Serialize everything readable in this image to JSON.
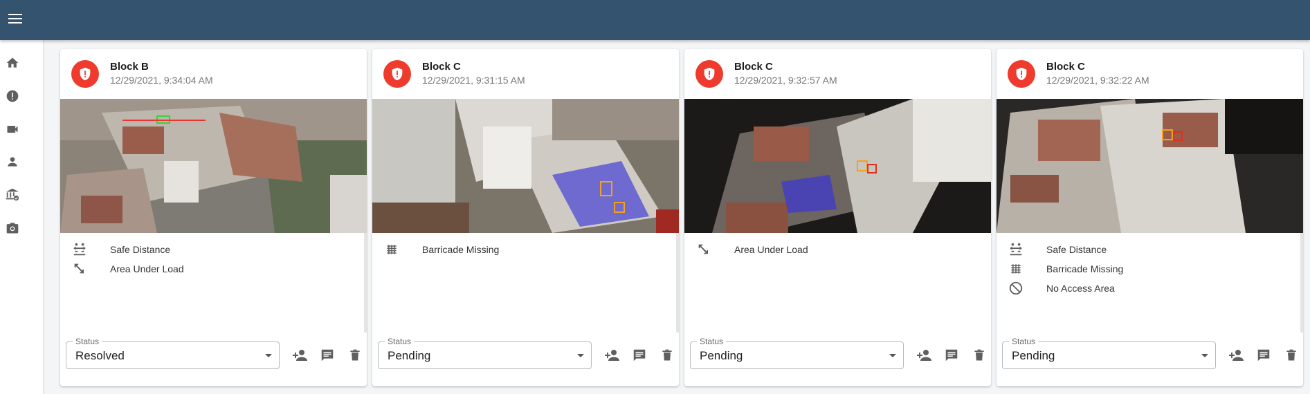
{
  "status_field_label": "Status",
  "colors": {
    "appbar": "#34536f",
    "alert": "#ef3b2d",
    "icon": "#5f5f5f"
  },
  "nav_items": [
    "home-icon",
    "alert-icon",
    "camera-icon",
    "person-icon",
    "site-icon",
    "photo-camera-icon"
  ],
  "cards": [
    {
      "title": "Block B",
      "timestamp": "12/29/2021, 9:34:04 AM",
      "violations": [
        {
          "icon": "safe-distance-icon",
          "label": "Safe Distance"
        },
        {
          "icon": "area-under-load-icon",
          "label": "Area Under Load"
        }
      ],
      "status": "Resolved"
    },
    {
      "title": "Block C",
      "timestamp": "12/29/2021, 9:31:15 AM",
      "violations": [
        {
          "icon": "barricade-icon",
          "label": "Barricade Missing"
        }
      ],
      "status": "Pending"
    },
    {
      "title": "Block C",
      "timestamp": "12/29/2021, 9:32:57 AM",
      "violations": [
        {
          "icon": "area-under-load-icon",
          "label": "Area Under Load"
        }
      ],
      "status": "Pending"
    },
    {
      "title": "Block C",
      "timestamp": "12/29/2021, 9:32:22 AM",
      "violations": [
        {
          "icon": "safe-distance-icon",
          "label": "Safe Distance"
        },
        {
          "icon": "barricade-icon",
          "label": "Barricade Missing"
        },
        {
          "icon": "no-access-icon",
          "label": "No Access Area"
        }
      ],
      "status": "Pending"
    }
  ]
}
